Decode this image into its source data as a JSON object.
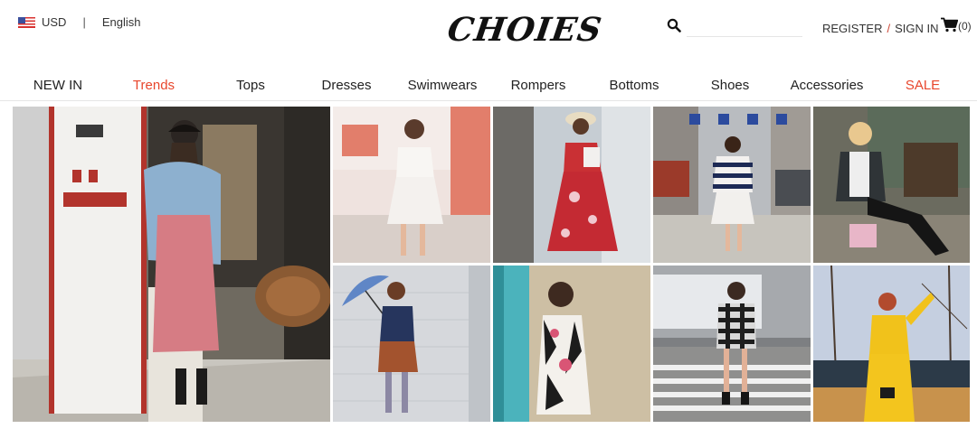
{
  "header": {
    "currency": "USD",
    "separator": "|",
    "language": "English",
    "logo_text": "CHOIES",
    "search_placeholder": "",
    "register": "REGISTER",
    "account_separator": "/",
    "sign_in": "SIGN IN",
    "cart_count": "(0)"
  },
  "nav": {
    "items": [
      "NEW IN",
      "Trends",
      "Tops",
      "Dresses",
      "Swimwears",
      "Rompers",
      "Bottoms",
      "Shoes",
      "Accessories",
      "SALE"
    ]
  },
  "colors": {
    "accent_red": "#e8462c",
    "text": "#222222"
  },
  "icons": {
    "flag": "us-flag-icon",
    "search": "search-icon",
    "cart": "cart-icon"
  },
  "gallery": {
    "photos": [
      "street-style-photo-denim-jacket",
      "street-style-photo-white-dress",
      "street-style-photo-floral-dress",
      "street-style-photo-striped-sweater",
      "street-style-photo-denim-vest",
      "street-style-photo-blue-umbrella",
      "street-style-photo-printed-dress",
      "street-style-photo-plaid-romper",
      "street-style-photo-yellow-dress"
    ]
  }
}
